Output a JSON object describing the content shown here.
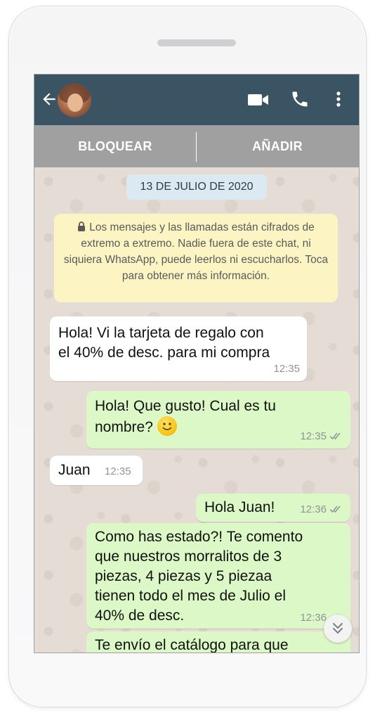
{
  "header": {
    "back_icon": "arrow-left-icon",
    "avatar_icon": "contact-avatar",
    "video_icon": "video-camera-icon",
    "call_icon": "phone-icon",
    "more_icon": "more-vertical-icon"
  },
  "actions": {
    "block_label": "BLOQUEAR",
    "add_label": "AÑADIR"
  },
  "chat": {
    "date": "13 DE JULIO DE 2020",
    "encryption_notice": "Los mensajes y las llamadas están cifrados de extremo a extremo. Nadie fuera de este chat, ni siquiera WhatsApp, puede leerlos ni escucharlos. Toca para obtener más información.",
    "messages": [
      {
        "direction": "incoming",
        "text": "Hola! Vi la tarjeta de regalo con\nel 40% de desc. para mi compra",
        "time": "12:35"
      },
      {
        "direction": "outgoing",
        "text": "Hola! Que gusto! Cual es tu\nnombre?",
        "emoji": "slightly-smiling-face",
        "time": "12:35",
        "status": "read"
      },
      {
        "direction": "incoming",
        "text": "Juan",
        "time": "12:35"
      },
      {
        "direction": "outgoing",
        "text": "Hola Juan!",
        "time": "12:36",
        "status": "read"
      },
      {
        "direction": "outgoing",
        "text": "Como has estado?! Te comento\nque nuestros morralitos de 3\npiezas, 4 piezas y 5 piezaa\ntienen todo el mes de Julio el\n40% de desc.",
        "time": "12:36",
        "status": "read"
      },
      {
        "direction": "outgoing",
        "text": "Te envío el catálogo para que",
        "partial": true
      }
    ]
  },
  "colors": {
    "header_bg": "#3b5463",
    "action_bar_bg": "#a0a0a0",
    "incoming_bubble": "#ffffff",
    "outgoing_bubble": "#dcf8c6",
    "encryption_bg": "#fcf4c3",
    "date_chip_bg": "#dbe9f3",
    "read_ticks": "#8f9499"
  },
  "scroll_down_icon": "double-chevron-down-icon"
}
